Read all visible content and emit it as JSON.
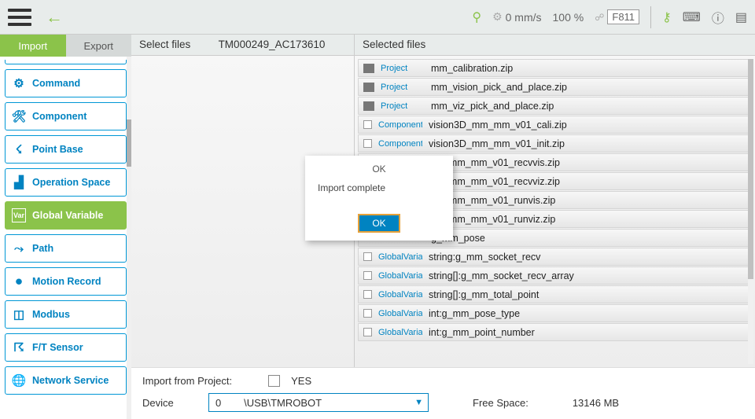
{
  "topbar": {
    "speed": "0 mm/s",
    "percent": "100 %",
    "fcode": "F811"
  },
  "tabs": {
    "import": "Import",
    "export": "Export"
  },
  "sidebar": {
    "items": [
      {
        "label": "Command"
      },
      {
        "label": "Component"
      },
      {
        "label": "Point Base"
      },
      {
        "label": "Operation Space"
      },
      {
        "label": "Global Variable"
      },
      {
        "label": "Path"
      },
      {
        "label": "Motion Record"
      },
      {
        "label": "Modbus"
      },
      {
        "label": "F/T Sensor"
      },
      {
        "label": "Network Service"
      }
    ]
  },
  "headers": {
    "select_files": "Select files",
    "source_folder": "TM000249_AC173610",
    "selected_files": "Selected files"
  },
  "files": [
    {
      "type": "Project",
      "name": "mm_calibration.zip",
      "icon": "folder"
    },
    {
      "type": "Project",
      "name": "mm_vision_pick_and_place.zip",
      "icon": "folder"
    },
    {
      "type": "Project",
      "name": "mm_viz_pick_and_place.zip",
      "icon": "folder"
    },
    {
      "type": "Component",
      "name": "vision3D_mm_mm_v01_cali.zip",
      "icon": "chk"
    },
    {
      "type": "Component",
      "name": "vision3D_mm_mm_v01_init.zip",
      "icon": "chk"
    },
    {
      "type": "",
      "name": "3D_mm_mm_v01_recvvis.zip",
      "icon": "none"
    },
    {
      "type": "",
      "name": "3D_mm_mm_v01_recvviz.zip",
      "icon": "none"
    },
    {
      "type": "",
      "name": "3D_mm_mm_v01_runvis.zip",
      "icon": "none"
    },
    {
      "type": "",
      "name": "3D_mm_mm_v01_runviz.zip",
      "icon": "none"
    },
    {
      "type": "",
      "name": "g_mm_pose",
      "icon": "none"
    },
    {
      "type": "GlobalVariable",
      "name": "string:g_mm_socket_recv",
      "icon": "chk"
    },
    {
      "type": "GlobalVariable",
      "name": "string[]:g_mm_socket_recv_array",
      "icon": "chk"
    },
    {
      "type": "GlobalVariable",
      "name": "string[]:g_mm_total_point",
      "icon": "chk"
    },
    {
      "type": "GlobalVariable",
      "name": "int:g_mm_pose_type",
      "icon": "chk"
    },
    {
      "type": "GlobalVariable",
      "name": "int:g_mm_point_number",
      "icon": "chk"
    }
  ],
  "footer": {
    "import_from_project": "Import from Project:",
    "yes": "YES",
    "device_label": "Device",
    "device_value": "0        \\USB\\TMROBOT",
    "free_space_label": "Free Space:",
    "free_space_value": "13146 MB"
  },
  "modal": {
    "title": "OK",
    "message": "Import complete",
    "ok": "OK"
  }
}
